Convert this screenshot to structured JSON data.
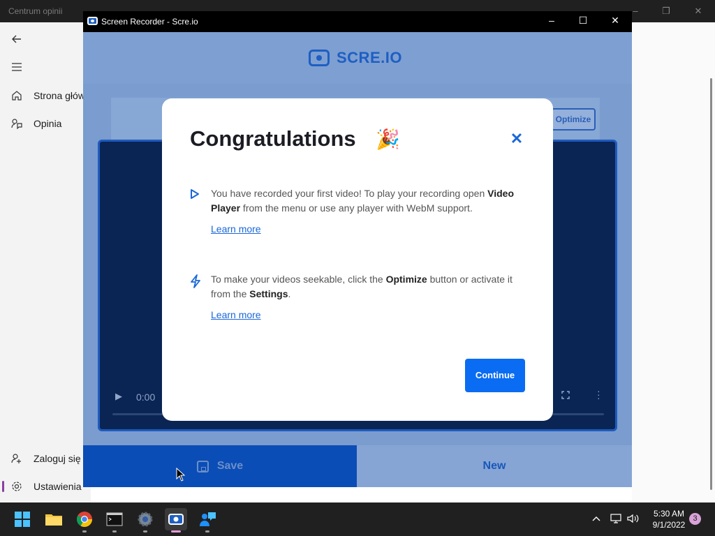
{
  "background_app": {
    "title": "Centrum opinii",
    "nav": {
      "back_icon": "arrow-left-icon",
      "menu_icon": "hamburger-icon",
      "items": [
        {
          "label": "Strona głów",
          "icon": "home-icon"
        },
        {
          "label": "Opinia",
          "icon": "feedback-icon"
        }
      ],
      "bottom_items": [
        {
          "label": "Zaloguj się",
          "icon": "person-add-icon"
        },
        {
          "label": "Ustawienia",
          "icon": "gear-icon",
          "active": true
        }
      ]
    }
  },
  "recorder": {
    "window_title": "Screen Recorder - Scre.io",
    "logo_text": "SCRE.IO",
    "optimize_label": "Optimize",
    "video": {
      "time": "0:00"
    },
    "save_label": "Save",
    "new_label": "New"
  },
  "modal": {
    "title": "Congratulations",
    "items": [
      {
        "icon": "play-outline-icon",
        "text_before": "You have recorded your first video! To play your recording open ",
        "bold1": "Video Player",
        "text_after": " from the menu or use any player with WebM support.",
        "link": "Learn more"
      },
      {
        "icon": "lightning-icon",
        "text_before": "To make your videos seekable, click the ",
        "bold1": "Optimize",
        "text_mid": " button or activate it from the ",
        "bold2": "Settings",
        "text_after": ".",
        "link": "Learn more"
      }
    ],
    "continue_label": "Continue"
  },
  "taskbar": {
    "apps": [
      "start-icon",
      "file-explorer-icon",
      "chrome-icon",
      "terminal-icon",
      "settings-icon",
      "screen-recorder-icon",
      "feedback-hub-icon"
    ],
    "time": "5:30 AM",
    "date": "9/1/2022",
    "notification_count": "3"
  },
  "colors": {
    "accent": "#0a6cf2",
    "overlay": "#7e9fd1",
    "video_bg": "#0a2454"
  }
}
